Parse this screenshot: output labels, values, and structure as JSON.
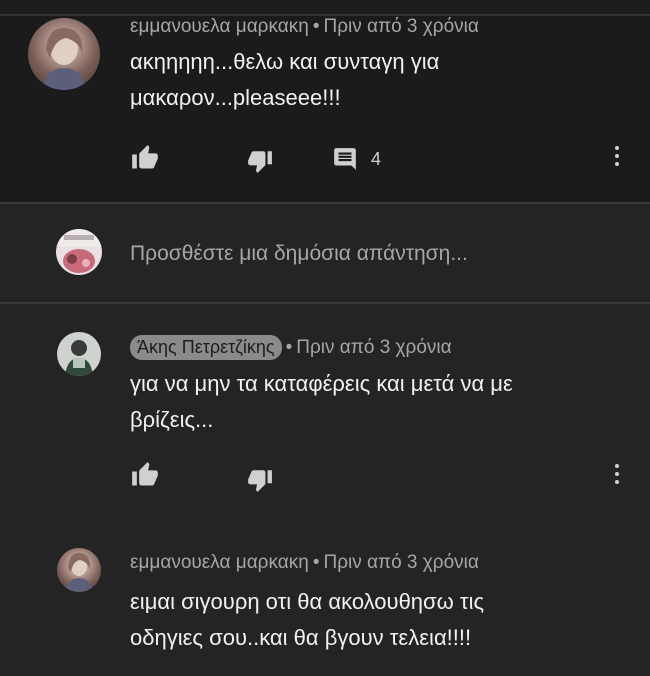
{
  "comments": [
    {
      "author": "εμμανουελα μαρκακη",
      "time": "Πριν από 3 χρόνια",
      "text_lines": [
        "ακηηηηη...θελω και συνταγη για",
        "μακαρον...pleaseee!!!"
      ],
      "reply_count": "4"
    },
    {
      "author": "Άκης Πετρετζίκης",
      "time": "Πριν από 3 χρόνια",
      "text_lines": [
        "για να μην τα καταφέρεις και μετά να με",
        "βρίζεις..."
      ]
    },
    {
      "author": "εμμανουελα μαρκακη",
      "time": "Πριν από 3 χρόνια",
      "text_lines": [
        "ειμαι σιγουρη οτι θα ακολουθησω τις",
        "οδηγιες σου..και θα βγουν τελεια!!!!"
      ]
    }
  ],
  "reply_box": {
    "placeholder": "Προσθέστε μια δημόσια απάντηση..."
  },
  "meta_separator": "•",
  "icons": {
    "like": "thumbs-up-icon",
    "dislike": "thumbs-down-icon",
    "replies": "comment-icon",
    "more": "more-vertical-icon"
  },
  "colors": {
    "background": "#242424",
    "highlight_background": "#1b1b1b",
    "author_badge": "#8a8a8a",
    "meta_text": "#a6a6a6"
  }
}
